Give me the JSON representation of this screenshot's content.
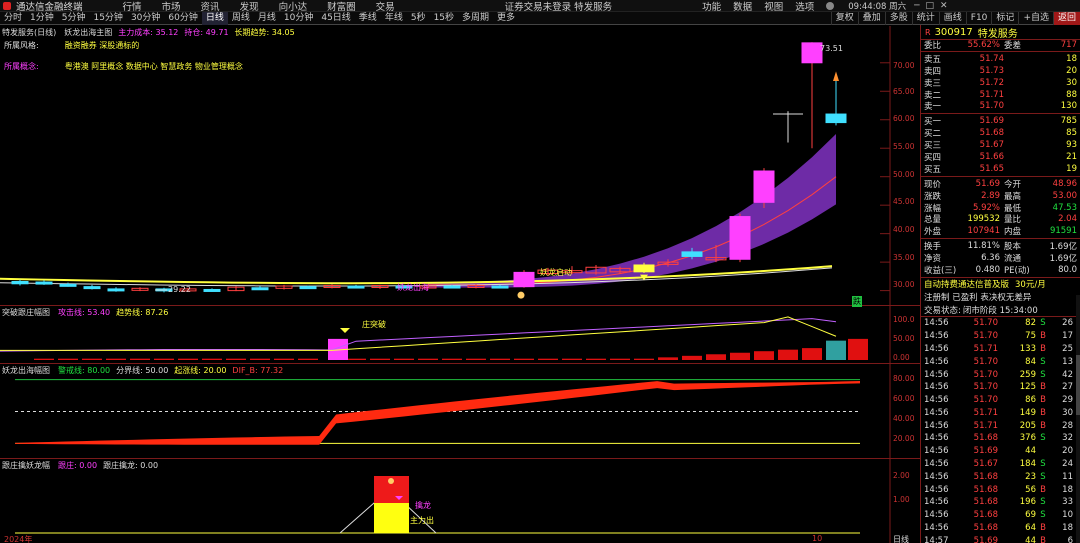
{
  "titlebar": {
    "app_title": "通达信金融终端",
    "menus": [
      "行情",
      "市场",
      "资讯",
      "发现",
      "向小达",
      "财富圈",
      "交易"
    ],
    "notice": "证券交易未登录  特发服务",
    "right_items": [
      "功能",
      "数据",
      "视图",
      "选项"
    ],
    "time": "09:44:08 周六"
  },
  "toolbar": {
    "timeframes": [
      "分时",
      "1分钟",
      "5分钟",
      "15分钟",
      "30分钟",
      "60分钟",
      "日线",
      "周线",
      "月线",
      "10分钟",
      "45日线",
      "季线",
      "年线",
      "5秒",
      "15秒",
      "多周期",
      "更多"
    ],
    "active": "日线",
    "right_tools": [
      "复权",
      "叠加",
      "多股",
      "统计",
      "画线",
      "F10",
      "标记",
      "+自选",
      "返回"
    ]
  },
  "main_pane": {
    "title": "特发服务(日线)",
    "indicator": "妖龙出海主图",
    "ind_vals": [
      {
        "label": "主力成本: 35.12",
        "color": "#ff40ff"
      },
      {
        "label": "持仓: 49.71",
        "color": "#ff40ff"
      },
      {
        "label": "长期趋势: 34.05",
        "color": "#ffff40"
      }
    ],
    "style_label": "所属风格:",
    "style_value": "融资融券 深股通标的",
    "concept_label": "所属概念:",
    "concept_value": "粤港澳 阿里概念 数据中心 智慧政务 物业管理概念",
    "y_ticks": [
      "70.00",
      "65.00",
      "60.00",
      "55.00",
      "50.00",
      "45.00",
      "40.00",
      "35.00",
      "30.00"
    ],
    "high_label": "73.51",
    "low_label": "29.22",
    "signal1": "妖龙出海",
    "signal2": "妖龙启动",
    "badge": "跌"
  },
  "pane2": {
    "title": "突破跟庄幅图",
    "vals": [
      {
        "label": "攻击线: 53.40",
        "color": "#ff40ff"
      },
      {
        "label": "趋势线: 87.26",
        "color": "#ffff40"
      }
    ],
    "signal": "庄突破",
    "y_ticks": [
      "100.0",
      "50.00",
      "0.00"
    ]
  },
  "pane3": {
    "title": "妖龙出海幅图",
    "vals": [
      {
        "label": "警戒线: 80.00",
        "color": "#20e040"
      },
      {
        "label": "分界线: 50.00",
        "color": "#ddd"
      },
      {
        "label": "起涨线: 20.00",
        "color": "#ffff40"
      },
      {
        "label": "DIF_B: 77.32",
        "color": "#ff4040"
      }
    ],
    "y_ticks": [
      "80.00",
      "60.00",
      "40.00",
      "20.00"
    ]
  },
  "pane4": {
    "title": "跟庄擒妖龙幅",
    "vals": [
      {
        "label": "跟庄: 0.00",
        "color": "#ff40ff"
      },
      {
        "label": "跟庄擒龙: 0.00",
        "color": "#ddd"
      }
    ],
    "signal1": "擒龙",
    "signal2": "主力出",
    "y_ticks": [
      "2.00",
      "1.00"
    ],
    "x_start": "2024年",
    "x_mark": "10",
    "period": "日线"
  },
  "quote": {
    "code": "300917",
    "name": "特发服务",
    "commit_ratio_label": "委比",
    "commit_ratio": "55.62%",
    "commit_diff_label": "委差",
    "commit_diff": "717",
    "asks": [
      {
        "label": "卖五",
        "price": "51.74",
        "vol": "18"
      },
      {
        "label": "卖四",
        "price": "51.73",
        "vol": "20"
      },
      {
        "label": "卖三",
        "price": "51.72",
        "vol": "30"
      },
      {
        "label": "卖二",
        "price": "51.71",
        "vol": "88"
      },
      {
        "label": "卖一",
        "price": "51.70",
        "vol": "130"
      }
    ],
    "bids": [
      {
        "label": "买一",
        "price": "51.69",
        "vol": "785"
      },
      {
        "label": "买二",
        "price": "51.68",
        "vol": "85"
      },
      {
        "label": "买三",
        "price": "51.67",
        "vol": "93"
      },
      {
        "label": "买四",
        "price": "51.66",
        "vol": "21"
      },
      {
        "label": "买五",
        "price": "51.65",
        "vol": "19"
      }
    ],
    "stats": [
      {
        "l1": "现价",
        "v1": "51.69",
        "c1": "#ff4040",
        "l2": "今开",
        "v2": "48.96",
        "c2": "#ff4040"
      },
      {
        "l1": "涨跌",
        "v1": "2.89",
        "c1": "#ff4040",
        "l2": "最高",
        "v2": "53.00",
        "c2": "#ff4040"
      },
      {
        "l1": "涨幅",
        "v1": "5.92%",
        "c1": "#ff4040",
        "l2": "最低",
        "v2": "47.53",
        "c2": "#20e040"
      },
      {
        "l1": "总量",
        "v1": "199532",
        "c1": "#ffff40",
        "l2": "量比",
        "v2": "2.04",
        "c2": "#ff4040"
      },
      {
        "l1": "外盘",
        "v1": "107941",
        "c1": "#ff4040",
        "l2": "内盘",
        "v2": "91591",
        "c2": "#20e040"
      }
    ],
    "stats2": [
      {
        "l1": "换手",
        "v1": "11.81%",
        "l2": "股本",
        "v2": "1.69亿"
      },
      {
        "l1": "净资",
        "v1": "6.36",
        "l2": "流通",
        "v2": "1.69亿"
      },
      {
        "l1": "收益(三)",
        "v1": "0.480",
        "l2": "PE(动)",
        "v2": "80.0"
      }
    ],
    "promo1": "自动持费通达信普及版",
    "promo2": "30元/月",
    "reg_line": "注册制 已盈利 表决权无差异",
    "trade_status_label": "交易状态:",
    "trade_status": "闭市阶段 15:34:00",
    "ticks": [
      {
        "t": "14:56",
        "p": "51.70",
        "pc": "#ff4040",
        "v": "82",
        "s": "S",
        "n": "26"
      },
      {
        "t": "14:56",
        "p": "51.70",
        "pc": "#ff4040",
        "v": "75",
        "s": "B",
        "n": "17"
      },
      {
        "t": "14:56",
        "p": "51.71",
        "pc": "#ff4040",
        "v": "133",
        "s": "B",
        "n": "25"
      },
      {
        "t": "14:56",
        "p": "51.70",
        "pc": "#ff4040",
        "v": "84",
        "s": "S",
        "n": "13"
      },
      {
        "t": "14:56",
        "p": "51.70",
        "pc": "#ff4040",
        "v": "259",
        "s": "S",
        "n": "42"
      },
      {
        "t": "14:56",
        "p": "51.70",
        "pc": "#ff4040",
        "v": "125",
        "s": "B",
        "n": "27"
      },
      {
        "t": "14:56",
        "p": "51.70",
        "pc": "#ff4040",
        "v": "86",
        "s": "B",
        "n": "29"
      },
      {
        "t": "14:56",
        "p": "51.71",
        "pc": "#ff4040",
        "v": "149",
        "s": "B",
        "n": "30"
      },
      {
        "t": "14:56",
        "p": "51.71",
        "pc": "#ff4040",
        "v": "205",
        "s": "B",
        "n": "28"
      },
      {
        "t": "14:56",
        "p": "51.68",
        "pc": "#ff4040",
        "v": "376",
        "s": "S",
        "n": "32"
      },
      {
        "t": "14:56",
        "p": "51.69",
        "pc": "#ff4040",
        "v": "44",
        "s": "",
        "n": "20"
      },
      {
        "t": "14:56",
        "p": "51.67",
        "pc": "#ff4040",
        "v": "184",
        "s": "S",
        "n": "24"
      },
      {
        "t": "14:56",
        "p": "51.68",
        "pc": "#ff4040",
        "v": "23",
        "s": "S",
        "n": "11"
      },
      {
        "t": "14:56",
        "p": "51.68",
        "pc": "#ff4040",
        "v": "56",
        "s": "B",
        "n": "18"
      },
      {
        "t": "14:56",
        "p": "51.68",
        "pc": "#ff4040",
        "v": "196",
        "s": "S",
        "n": "33"
      },
      {
        "t": "14:56",
        "p": "51.68",
        "pc": "#ff4040",
        "v": "69",
        "s": "S",
        "n": "10"
      },
      {
        "t": "14:56",
        "p": "51.68",
        "pc": "#ff4040",
        "v": "64",
        "s": "B",
        "n": "18"
      },
      {
        "t": "14:57",
        "p": "51.69",
        "pc": "#ff4040",
        "v": "44",
        "s": "B",
        "n": "6"
      }
    ]
  },
  "chart_data": {
    "type": "candlestick",
    "y_range": [
      28,
      74
    ],
    "candles": [
      {
        "i": 1,
        "o": 31.2,
        "c": 31.6,
        "h": 31.9,
        "l": 30.9,
        "color": "#40e0ff"
      },
      {
        "i": 2,
        "o": 31.5,
        "c": 31.3,
        "h": 31.8,
        "l": 31.0,
        "color": "#40e0ff"
      },
      {
        "i": 3,
        "o": 31.1,
        "c": 30.9,
        "h": 31.4,
        "l": 30.7,
        "color": "#40e0ff"
      },
      {
        "i": 4,
        "o": 30.7,
        "c": 30.4,
        "h": 31.0,
        "l": 30.2,
        "color": "#40e0ff"
      },
      {
        "i": 5,
        "o": 30.3,
        "c": 30.1,
        "h": 30.6,
        "l": 29.8,
        "color": "#40e0ff"
      },
      {
        "i": 6,
        "o": 30.1,
        "c": 30.4,
        "h": 30.6,
        "l": 29.9,
        "color": "#ff4040"
      },
      {
        "i": 7,
        "o": 30.3,
        "c": 30.0,
        "h": 30.5,
        "l": 29.7,
        "color": "#40e0ff"
      },
      {
        "i": 8,
        "o": 30.1,
        "c": 30.3,
        "h": 30.5,
        "l": 29.9,
        "color": "#ff4040"
      },
      {
        "i": 9,
        "o": 30.2,
        "c": 30.0,
        "h": 30.4,
        "l": 29.8,
        "color": "#40e0ff"
      },
      {
        "i": 10,
        "o": 30.0,
        "c": 30.6,
        "h": 30.8,
        "l": 29.9,
        "color": "#ff4040"
      },
      {
        "i": 11,
        "o": 30.5,
        "c": 30.3,
        "h": 30.8,
        "l": 30.1,
        "color": "#40e0ff"
      },
      {
        "i": 12,
        "o": 30.4,
        "c": 30.8,
        "h": 31.0,
        "l": 30.2,
        "color": "#ff4040"
      },
      {
        "i": 13,
        "o": 30.7,
        "c": 30.5,
        "h": 30.9,
        "l": 30.3,
        "color": "#40e0ff"
      },
      {
        "i": 14,
        "o": 30.6,
        "c": 30.9,
        "h": 31.1,
        "l": 30.4,
        "color": "#ff4040"
      },
      {
        "i": 15,
        "o": 30.8,
        "c": 30.6,
        "h": 31.0,
        "l": 30.4,
        "color": "#40e0ff"
      },
      {
        "i": 16,
        "o": 30.6,
        "c": 30.9,
        "h": 31.0,
        "l": 30.3,
        "color": "#ff4040"
      },
      {
        "i": 17,
        "o": 30.8,
        "c": 30.7,
        "h": 31.0,
        "l": 30.5,
        "color": "#40e0ff"
      },
      {
        "i": 18,
        "o": 30.6,
        "c": 30.8,
        "h": 31.0,
        "l": 30.4,
        "color": "#ff4040"
      },
      {
        "i": 19,
        "o": 30.8,
        "c": 30.6,
        "h": 31.0,
        "l": 30.4,
        "color": "#40e0ff"
      },
      {
        "i": 20,
        "o": 30.6,
        "c": 30.9,
        "h": 31.1,
        "l": 30.4,
        "color": "#ff4040"
      },
      {
        "i": 21,
        "o": 30.8,
        "c": 30.7,
        "h": 31.0,
        "l": 30.5,
        "color": "#40e0ff"
      },
      {
        "i": 22,
        "o": 30.7,
        "c": 33.2,
        "h": 33.6,
        "l": 30.5,
        "color": "#ff40ff"
      },
      {
        "i": 23,
        "o": 33.0,
        "c": 33.6,
        "h": 34.0,
        "l": 32.6,
        "color": "#ff4040"
      },
      {
        "i": 24,
        "o": 33.5,
        "c": 33.2,
        "h": 34.3,
        "l": 32.9,
        "color": "#ff4040"
      },
      {
        "i": 25,
        "o": 33.1,
        "c": 34.1,
        "h": 34.5,
        "l": 32.8,
        "color": "#ff4040"
      },
      {
        "i": 26,
        "o": 33.9,
        "c": 33.3,
        "h": 34.2,
        "l": 33.0,
        "color": "#ff4040"
      },
      {
        "i": 27,
        "o": 33.3,
        "c": 34.5,
        "h": 34.9,
        "l": 33.1,
        "color": "#ffff40"
      },
      {
        "i": 28,
        "o": 34.6,
        "c": 35.0,
        "h": 35.5,
        "l": 34.2,
        "color": "#ff4040"
      },
      {
        "i": 29,
        "o": 36.0,
        "c": 36.8,
        "h": 37.5,
        "l": 35.5,
        "color": "#40e0ff"
      },
      {
        "i": 30,
        "o": 35.4,
        "c": 35.8,
        "h": 38.0,
        "l": 35.0,
        "color": "#ff4040"
      },
      {
        "i": 31,
        "o": 35.5,
        "c": 43.0,
        "h": 43.5,
        "l": 35.0,
        "color": "#ff40ff"
      },
      {
        "i": 32,
        "o": 45.5,
        "c": 51.0,
        "h": 51.5,
        "l": 44.5,
        "color": "#ff40ff"
      },
      {
        "i": 33,
        "o": 56.5,
        "c": 61.0,
        "h": 61.5,
        "l": 56.0,
        "color": "#ddd"
      },
      {
        "i": 34,
        "o": 70.0,
        "c": 73.5,
        "h": 73.6,
        "l": 55.0,
        "color": "#ff40ff"
      },
      {
        "i": 35,
        "o": 59.5,
        "c": 61.0,
        "h": 67.0,
        "l": 59.0,
        "color": "#40e0ff"
      }
    ]
  }
}
